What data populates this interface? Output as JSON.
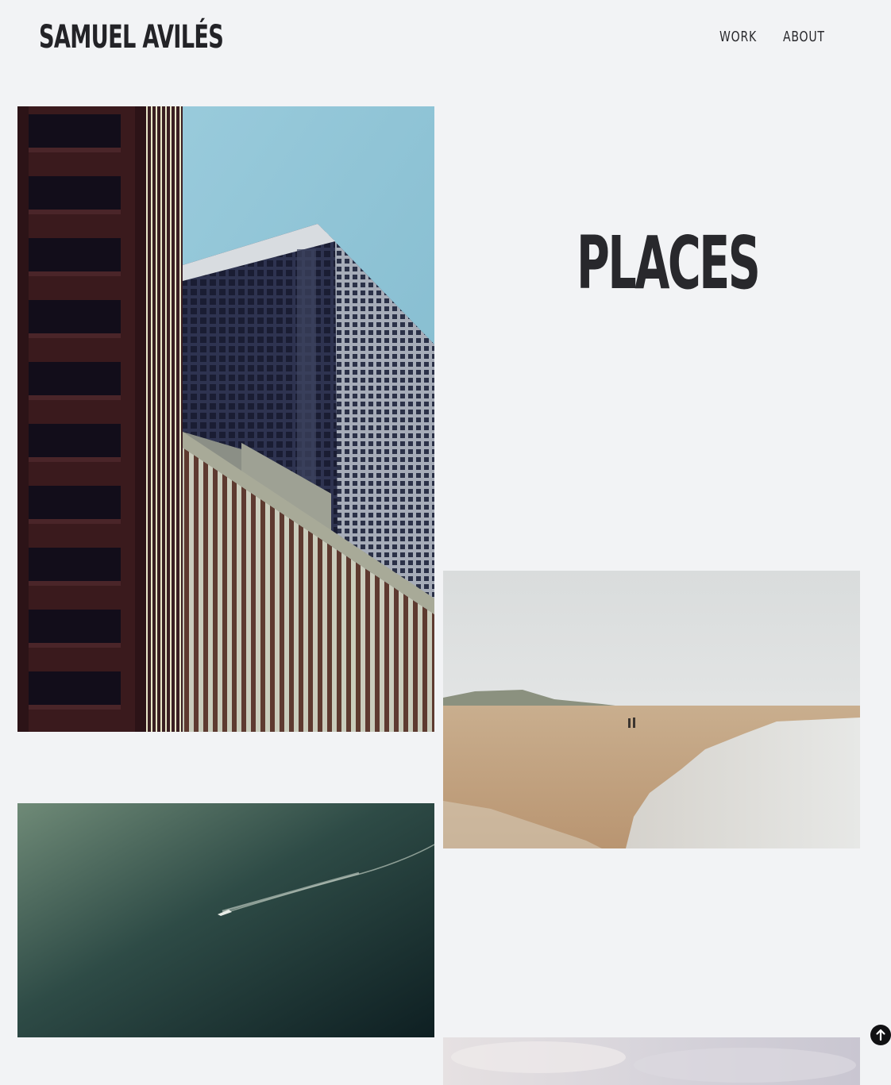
{
  "header": {
    "site_title": "SAMUEL AVILÉS",
    "nav": {
      "work": "WORK",
      "about": "ABOUT"
    }
  },
  "main": {
    "section_title": "PLACES",
    "photos": [
      {
        "subject": "skyscrapers against blue sky"
      },
      {
        "subject": "misty beach with two walkers"
      },
      {
        "subject": "boat wake on dark green sea"
      },
      {
        "subject": "cloudy pale sky"
      }
    ]
  },
  "ui": {
    "back_to_top_icon": "arrow-up-icon"
  },
  "colors": {
    "background": "#f2f3f5",
    "text": "#232327"
  }
}
